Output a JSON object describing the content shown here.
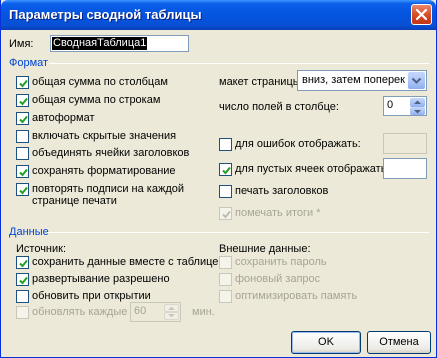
{
  "window": {
    "title": "Параметры сводной таблицы"
  },
  "name_field": {
    "label": "Имя:",
    "value": "СводнаяТаблица1"
  },
  "format": {
    "section_label": "Формат",
    "left_options": [
      {
        "label": "общая сумма по столбцам",
        "checked": true,
        "enabled": true
      },
      {
        "label": "общая сумма по строкам",
        "checked": true,
        "enabled": true
      },
      {
        "label": "автоформат",
        "checked": true,
        "enabled": true
      },
      {
        "label": "включать скрытые значения",
        "checked": false,
        "enabled": true
      },
      {
        "label": "объединять ячейки заголовков",
        "checked": false,
        "enabled": true
      },
      {
        "label": "сохранять форматирование",
        "checked": true,
        "enabled": true
      },
      {
        "label": "повторять подписи на каждой",
        "label2": "странице печати",
        "checked": true,
        "enabled": true
      }
    ],
    "page_layout": {
      "label": "макет страницы:",
      "value": "вниз, затем поперек"
    },
    "fields_per_column": {
      "label": "число полей в столбце:",
      "value": "0"
    },
    "error_values": {
      "label": "для ошибок отображать:",
      "checked": false,
      "value": ""
    },
    "empty_cells": {
      "label": "для пустых ячеек отображать:",
      "checked": true,
      "value": ""
    },
    "print_titles": {
      "label": "печать заголовков",
      "checked": false
    },
    "mark_totals": {
      "label": "помечать итоги *",
      "checked": true,
      "enabled": false
    }
  },
  "data": {
    "section_label": "Данные",
    "source_label": "Источник:",
    "external_label": "Внешние данные:",
    "source_options": [
      {
        "label": "сохранить данные вместе с таблицей",
        "checked": true,
        "enabled": true
      },
      {
        "label": "развертывание разрешено",
        "checked": true,
        "enabled": true
      },
      {
        "label": "обновить при открытии",
        "checked": false,
        "enabled": true
      }
    ],
    "refresh_every": {
      "label": "обновлять каждые",
      "value": "60",
      "unit": "мин.",
      "enabled": false
    },
    "external_options": [
      {
        "label": "сохранить пароль",
        "enabled": false
      },
      {
        "label": "фоновый запрос",
        "enabled": false
      },
      {
        "label": "оптимизировать память",
        "enabled": false
      }
    ]
  },
  "buttons": {
    "ok": "OK",
    "cancel": "Отмена"
  },
  "colors": {
    "titlebar": "#0554e0",
    "section_title": "#0046d5",
    "dialog_bg": "#ece9d8",
    "check": "#21a121"
  }
}
